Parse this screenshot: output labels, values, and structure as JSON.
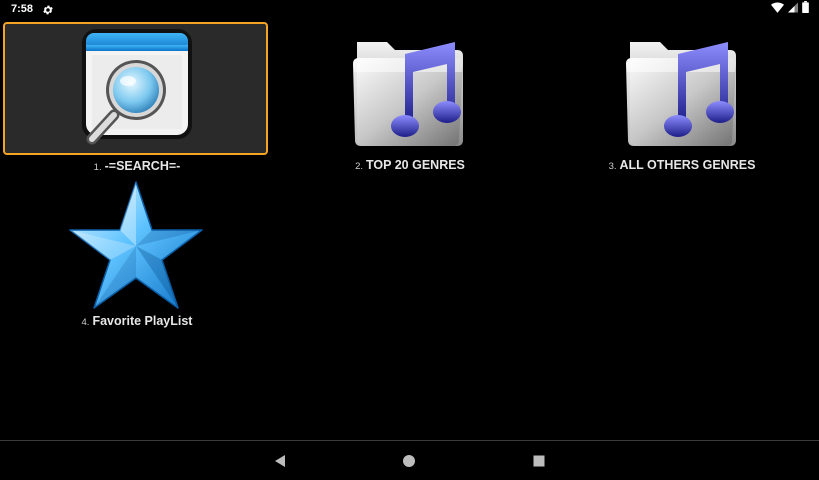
{
  "status_bar": {
    "time": "7:58",
    "icons": [
      "settings-gear-icon",
      "wifi-icon",
      "signal-icon",
      "battery-icon"
    ]
  },
  "grid": {
    "items": [
      {
        "index": "1.",
        "label": "-=SEARCH=-",
        "icon": "search-window-icon",
        "selected": true
      },
      {
        "index": "2.",
        "label": "TOP 20 GENRES",
        "icon": "music-folder-icon",
        "selected": false
      },
      {
        "index": "3.",
        "label": "ALL OTHERS GENRES",
        "icon": "music-folder-icon",
        "selected": false
      },
      {
        "index": "4.",
        "label": "Favorite PlayList",
        "icon": "star-icon",
        "selected": false
      }
    ]
  },
  "nav_bar": {
    "buttons": [
      "back-icon",
      "home-icon",
      "recents-icon"
    ]
  },
  "colors": {
    "selection_border": "#f4a425",
    "selection_fill": "#2a2a2a",
    "background": "#000000",
    "label_text": "#e6e6e6"
  }
}
